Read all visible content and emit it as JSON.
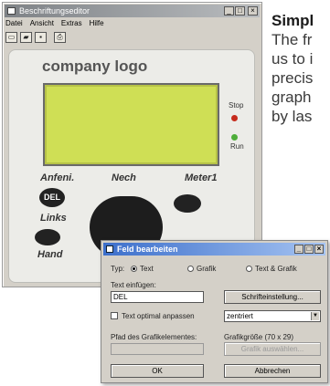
{
  "article": {
    "heading": "Simpl",
    "lines": [
      "The fr",
      "us to i",
      "precis",
      "graph",
      "by las"
    ]
  },
  "editor": {
    "title": "Beschriftungseditor",
    "title_buttons": [
      "_",
      "□",
      "×"
    ],
    "menu": [
      "Datei",
      "Ansicht",
      "Extras",
      "Hilfe"
    ],
    "toolbar_icons": [
      "new-file-icon",
      "open-folder-icon",
      "save-icon",
      "print-icon"
    ]
  },
  "device": {
    "logo": "company logo",
    "stop_label": "Stop",
    "run_label": "Run",
    "keys": {
      "top_left": "Anfeni.",
      "top_mid": "Nech",
      "top_right": "Meter1",
      "del": "DEL",
      "left": "Links",
      "bottom": "Hand"
    },
    "colors": {
      "lcd": "#cfdf55",
      "led_stop": "#c62b1c",
      "led_run": "#4eae3a"
    }
  },
  "dialog": {
    "title": "Feld bearbeiten",
    "typ_label": "Typ:",
    "type_options": [
      "Text",
      "Grafik",
      "Text & Grafik"
    ],
    "selected_type": "Text",
    "text_label": "Text einfügen:",
    "text_value": "DEL",
    "font_button": "Schrifteinstellung...",
    "optimal_label": "Text optimal anpassen",
    "align_value": "zentriert",
    "path_label": "Pfad des Grafikelementes:",
    "size_label": "Grafikgröße (70 x 29)",
    "choose_button": "Grafik auswählen...",
    "ok": "OK",
    "cancel": "Abbrechen"
  }
}
